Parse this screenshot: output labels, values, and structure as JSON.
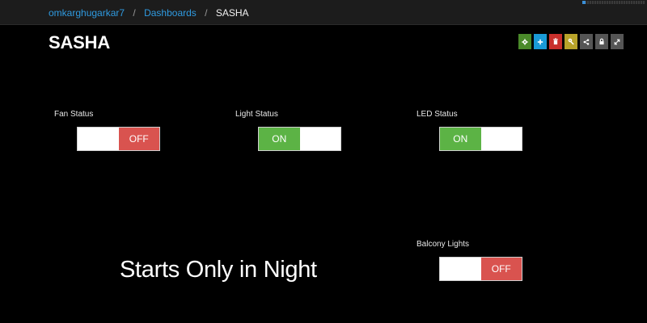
{
  "breadcrumb": {
    "user": "omkarghugarkar7",
    "section": "Dashboards",
    "current": "SASHA",
    "separator": "/"
  },
  "page": {
    "title": "SASHA"
  },
  "load_progress": 0.05,
  "toolbar": [
    {
      "icon": "gear-icon",
      "color": "#4a8a2a"
    },
    {
      "icon": "plus-icon",
      "color": "#1a9ad6"
    },
    {
      "icon": "trash-icon",
      "color": "#c9302c"
    },
    {
      "icon": "key-icon",
      "color": "#b8a32a"
    },
    {
      "icon": "share-icon",
      "color": "#555555"
    },
    {
      "icon": "lock-icon",
      "color": "#555555"
    },
    {
      "icon": "fullscreen-icon",
      "color": "#555555"
    }
  ],
  "widgets": {
    "fan": {
      "label": "Fan Status",
      "state": "OFF"
    },
    "light": {
      "label": "Light Status",
      "state": "ON"
    },
    "led": {
      "label": "LED Status",
      "state": "ON"
    },
    "balcony": {
      "label": "Balcony Lights",
      "state": "OFF"
    }
  },
  "note": "Starts Only in Night",
  "colors": {
    "on": "#5cb345",
    "off": "#d9534f",
    "link": "#2f9ae0",
    "background": "#000000"
  }
}
